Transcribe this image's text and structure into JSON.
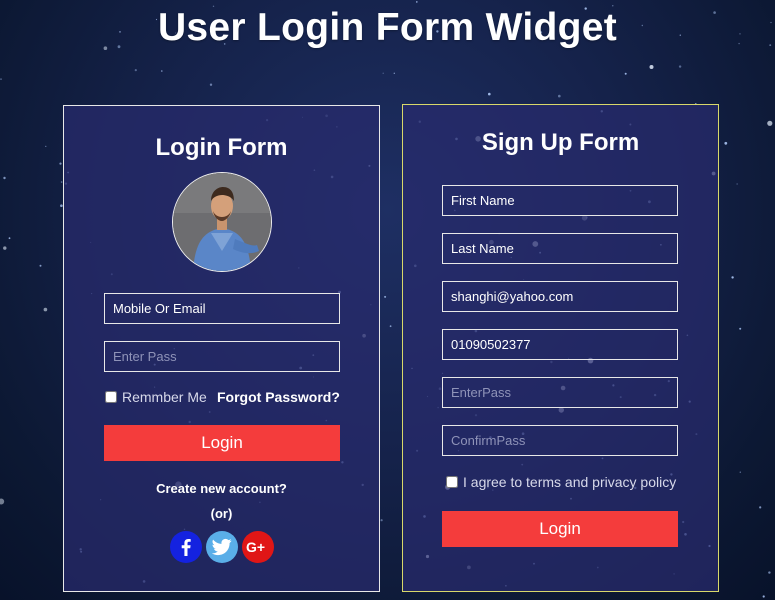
{
  "page": {
    "title": "User Login Form Widget"
  },
  "login": {
    "title": "Login Form",
    "avatar_icon": "user-photo",
    "email_placeholder": "Mobile Or Email",
    "password_placeholder": "Enter Pass",
    "remember_label": "Remmber Me",
    "forgot_label": "Forgot Password?",
    "button_label": "Login",
    "create_label": "Create new account?",
    "or_label": "(or)",
    "socials": [
      {
        "name": "facebook",
        "icon": "facebook-icon",
        "color": "#1422e0",
        "glyph": "f"
      },
      {
        "name": "twitter",
        "icon": "twitter-icon",
        "color": "#5aaee8",
        "glyph": "bird"
      },
      {
        "name": "google-plus",
        "icon": "google-plus-icon",
        "color": "#e01616",
        "glyph": "G+"
      }
    ]
  },
  "signup": {
    "title": "Sign Up Form",
    "first_name_placeholder": "First Name",
    "last_name_placeholder": "Last Name",
    "email_value": "shanghi@yahoo.com",
    "phone_value": "01090502377",
    "password_placeholder": "EnterPass",
    "confirm_placeholder": "ConfirmPass",
    "agree_label": "I agree to terms and privacy policy",
    "button_label": "Login"
  },
  "colors": {
    "button": "#f43c3c",
    "login_border": "#e8e8e8",
    "signup_border": "#d8d86a",
    "card_bg": "#282b6e"
  }
}
